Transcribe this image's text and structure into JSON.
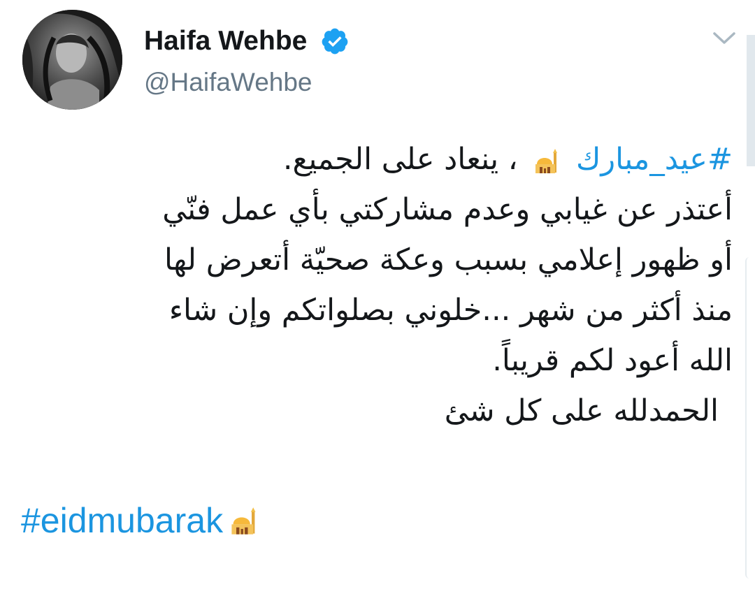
{
  "author": {
    "display_name": "Haifa Wehbe",
    "handle": "@HaifaWehbe",
    "verified": true,
    "avatar_icon": "profile-photo"
  },
  "tweet": {
    "hashtag_ar": "#عيد_مبارك",
    "line1_rest": "، ينعاد على الجميع.",
    "lines": [
      "أعتذر عن غيابي وعدم مشاركتي بأي عمل فنّي",
      "أو ظهور إعلامي بسبب وعكة صحيّة أتعرض لها",
      "منذ أكثر من شهر ...خلوني بصلواتكم وإن شاء",
      "الله أعود لكم قريباً."
    ],
    "closing_line": "الحمدلله على كل شئ",
    "hashtag_en": "#eidmubarak"
  },
  "icons": {
    "verified": "verified-badge-icon",
    "menu": "chevron-down-icon",
    "emoji": "mosque-emoji-icon"
  },
  "colors": {
    "link": "#1b95e0",
    "text": "#14171a",
    "secondary": "#657786"
  }
}
